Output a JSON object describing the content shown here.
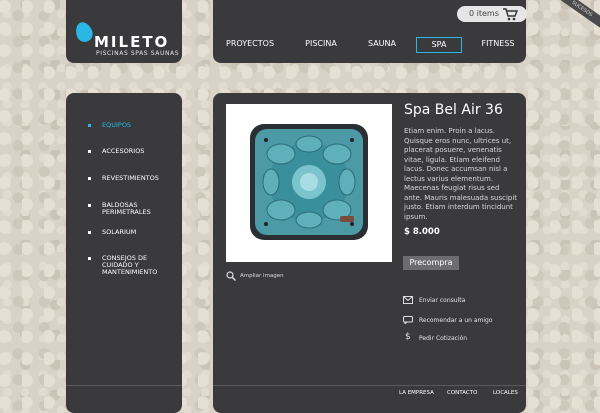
{
  "brand": {
    "name": "MILETO",
    "tagline": "PISCINAS SPAS SAUNAS"
  },
  "cart": {
    "count_text": "0 items"
  },
  "corner": {
    "label": "SUCESOS"
  },
  "nav": {
    "items": [
      "PROYECTOS",
      "PISCINA",
      "SAUNA",
      "SPA",
      "FITNESS"
    ],
    "active": "SPA"
  },
  "sidebar": {
    "items": [
      {
        "label": "EQUIPOS",
        "active": true
      },
      {
        "label": "ACCESORIOS"
      },
      {
        "label": "REVESTIMIENTOS"
      },
      {
        "label": "BALDOSAS PERIMETRALES"
      },
      {
        "label": "SOLARIUM"
      },
      {
        "label": "CONSEJOS DE CUIDADO Y MANTENIMIENTO"
      }
    ]
  },
  "product": {
    "title": "Spa Bel Air 36",
    "description": "Etiam enim. Proin a lacus. Quisque eros nunc, ultrices ut, placerat posuere, venenatis vitae, ligula. Etiam eleifend lacus. Donec accumsan nisl a lectus varius elementum. Maecenas feugiat risus sed ante. Mauris malesuada suscipit justo. Etiam interdum tincidunt ipsum.",
    "price": "$ 8.000",
    "buy_label": "Precompra",
    "zoom_label": "Ampliar imagen"
  },
  "actions": [
    {
      "label": "Enviar consulta",
      "icon": "mail-icon"
    },
    {
      "label": "Recomendar a un amigo",
      "icon": "chat-icon"
    },
    {
      "label": "Pedir Cotización",
      "icon": "dollar-icon"
    }
  ],
  "footer": {
    "links": [
      "LA EMPRESA",
      "CONTACTO",
      "LOCALES"
    ]
  },
  "colors": {
    "accent": "#2bb7e6",
    "panel": "#3a3a3c",
    "spa_water": "#3a8f9c"
  }
}
